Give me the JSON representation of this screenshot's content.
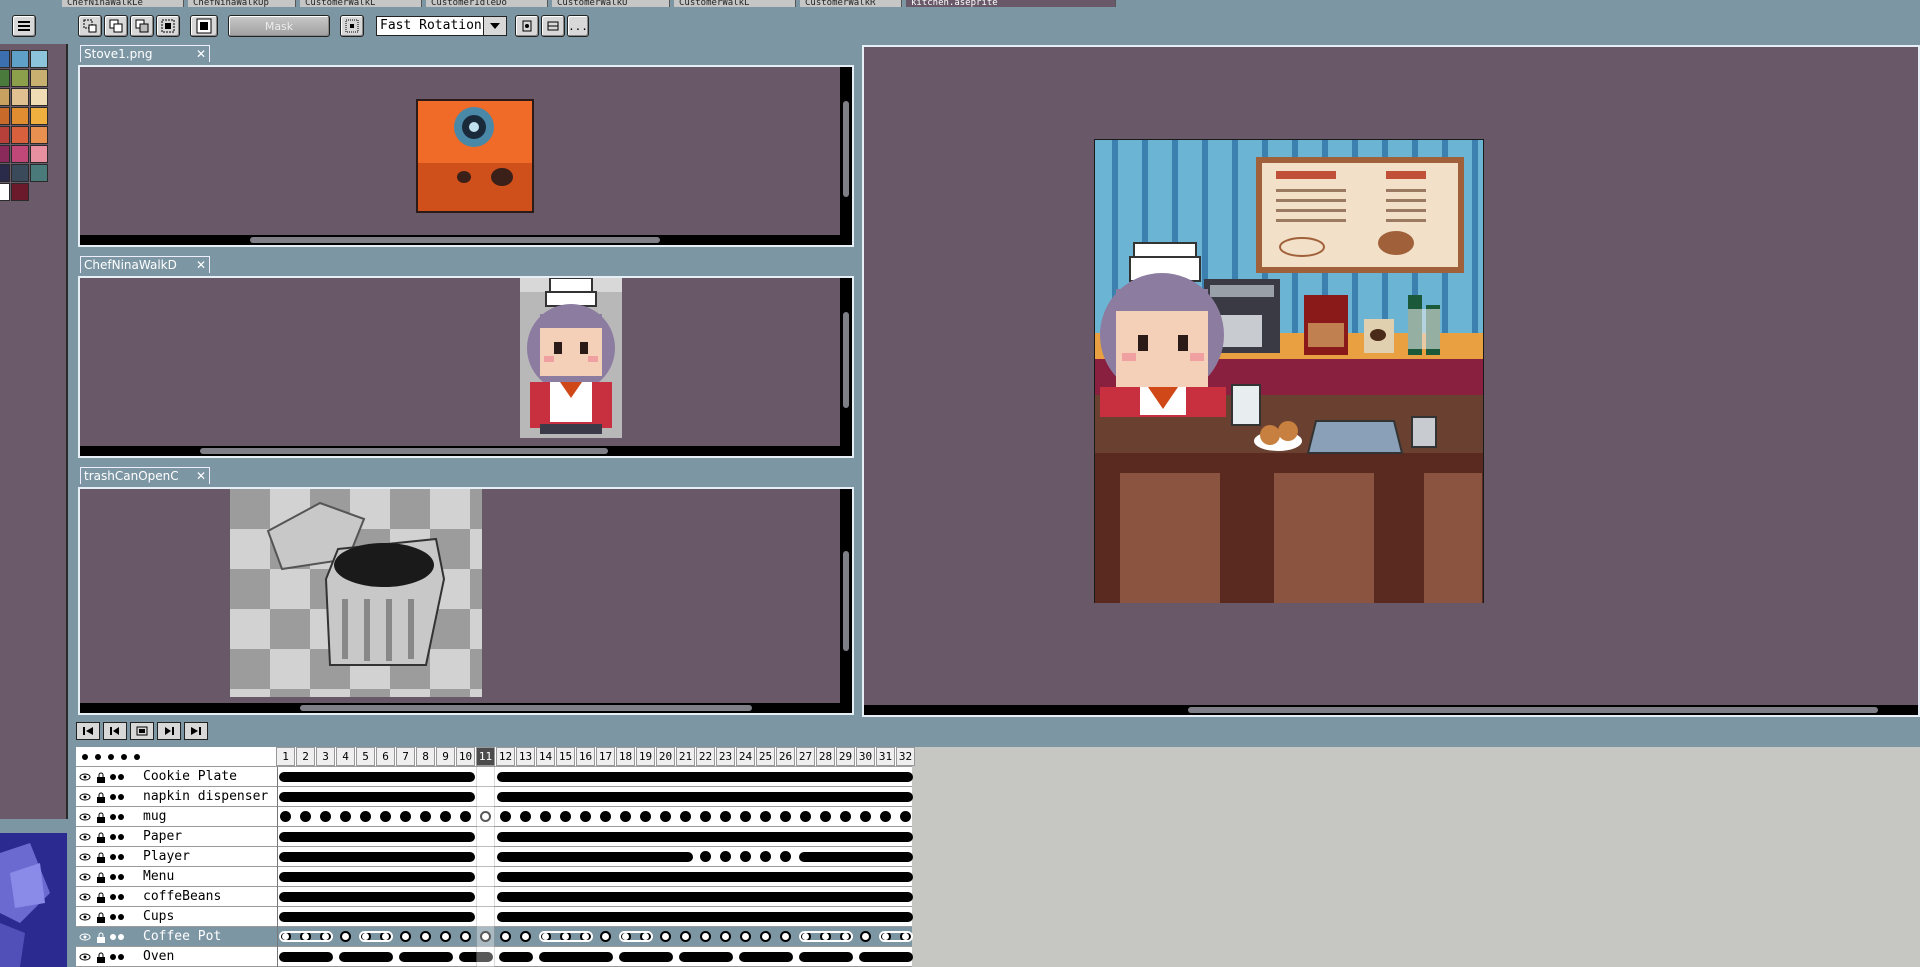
{
  "file_tabs": [
    {
      "label": "ChefNinaWalkLe",
      "active": false
    },
    {
      "label": "ChefNinaWalkUp",
      "active": false
    },
    {
      "label": "CustomerWalkL",
      "active": false
    },
    {
      "label": "CustomerIdleDo",
      "active": false
    },
    {
      "label": "CustomerWalkU",
      "active": false
    },
    {
      "label": "CustomerWalkL",
      "active": false
    },
    {
      "label": "CustomerWalkR",
      "active": false
    },
    {
      "label": "kitchen.aseprite",
      "active": true
    }
  ],
  "toolbar": {
    "mask_label": "Mask",
    "rotation_value": "Fast Rotation",
    "more_label": "..."
  },
  "palette_colors": [
    "#3b6fb0",
    "#5fa0c8",
    "#8cc4dc",
    "#4a7a3c",
    "#8ca04c",
    "#c8b070",
    "#c8a060",
    "#e0c090",
    "#f0dcb4",
    "#c86a2a",
    "#e08c30",
    "#f0b040",
    "#b8403a",
    "#d8603c",
    "#e89050",
    "#8a2a5a",
    "#c04878",
    "#e890a0",
    "#2a2a4a",
    "#3a4a5a",
    "#4a7a7a",
    "#ffffff",
    "#6a1a2a"
  ],
  "documents": [
    {
      "title": "Stove1.png",
      "close": "✕"
    },
    {
      "title": "ChefNinaWalkD",
      "close": "✕"
    },
    {
      "title": "trashCanOpenC",
      "close": "✕"
    }
  ],
  "timeline": {
    "current_frame": 11,
    "frames": [
      "1",
      "2",
      "3",
      "4",
      "5",
      "6",
      "7",
      "8",
      "9",
      "10",
      "11",
      "12",
      "13",
      "14",
      "15",
      "16",
      "17",
      "18",
      "19",
      "20",
      "21",
      "22",
      "23",
      "24",
      "25",
      "26",
      "27",
      "28",
      "29",
      "30",
      "31",
      "32"
    ],
    "layers": [
      {
        "name": "Cookie Plate",
        "selected": false
      },
      {
        "name": "napkin dispenser",
        "selected": false
      },
      {
        "name": "mug",
        "selected": false
      },
      {
        "name": "Paper",
        "selected": false
      },
      {
        "name": "Player",
        "selected": false
      },
      {
        "name": "Menu",
        "selected": false
      },
      {
        "name": "coffeBeans",
        "selected": false
      },
      {
        "name": "Cups",
        "selected": false
      },
      {
        "name": "Coffee Pot",
        "selected": true
      },
      {
        "name": "Oven",
        "selected": false
      }
    ]
  }
}
